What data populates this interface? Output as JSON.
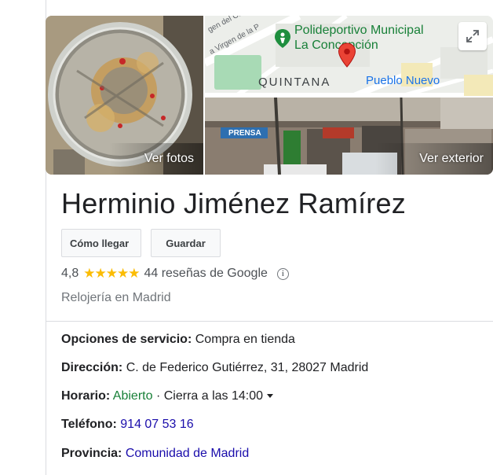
{
  "photos": {
    "main_caption": "Ver fotos",
    "street_caption": "Ver exterior",
    "expand_icon": "expand-icon"
  },
  "map": {
    "poi_name_line1": "Polideportivo Municipal",
    "poi_name_line2": "La Concepción",
    "district": "QUINTANA",
    "neighborhood": "Pueblo Nuevo",
    "street_a": "gen del Ca",
    "street_b": "a Virgen de la P",
    "accent_green": "#188038",
    "pin_color": "#ea4335"
  },
  "street_view": {
    "shop_sign": "PRENSA"
  },
  "business": {
    "name": "Herminio Jiménez Ramírez",
    "directions_label": "Cómo llegar",
    "save_label": "Guardar",
    "rating": "4,8",
    "stars": "★★★★★",
    "star_color": "#fbbc04",
    "reviews_label": "44 reseñas de Google",
    "category": "Relojería en Madrid"
  },
  "details": {
    "service_label": "Opciones de servicio:",
    "service_value": "Compra en tienda",
    "address_label": "Dirección:",
    "address_value": "C. de Federico Gutiérrez, 31, 28027 Madrid",
    "hours_label": "Horario:",
    "hours_status": "Abierto",
    "hours_detail": "· Cierra a las 14:00",
    "phone_label": "Teléfono:",
    "phone_value": "914 07 53 16",
    "province_label": "Provincia:",
    "province_value": "Comunidad de Madrid"
  }
}
